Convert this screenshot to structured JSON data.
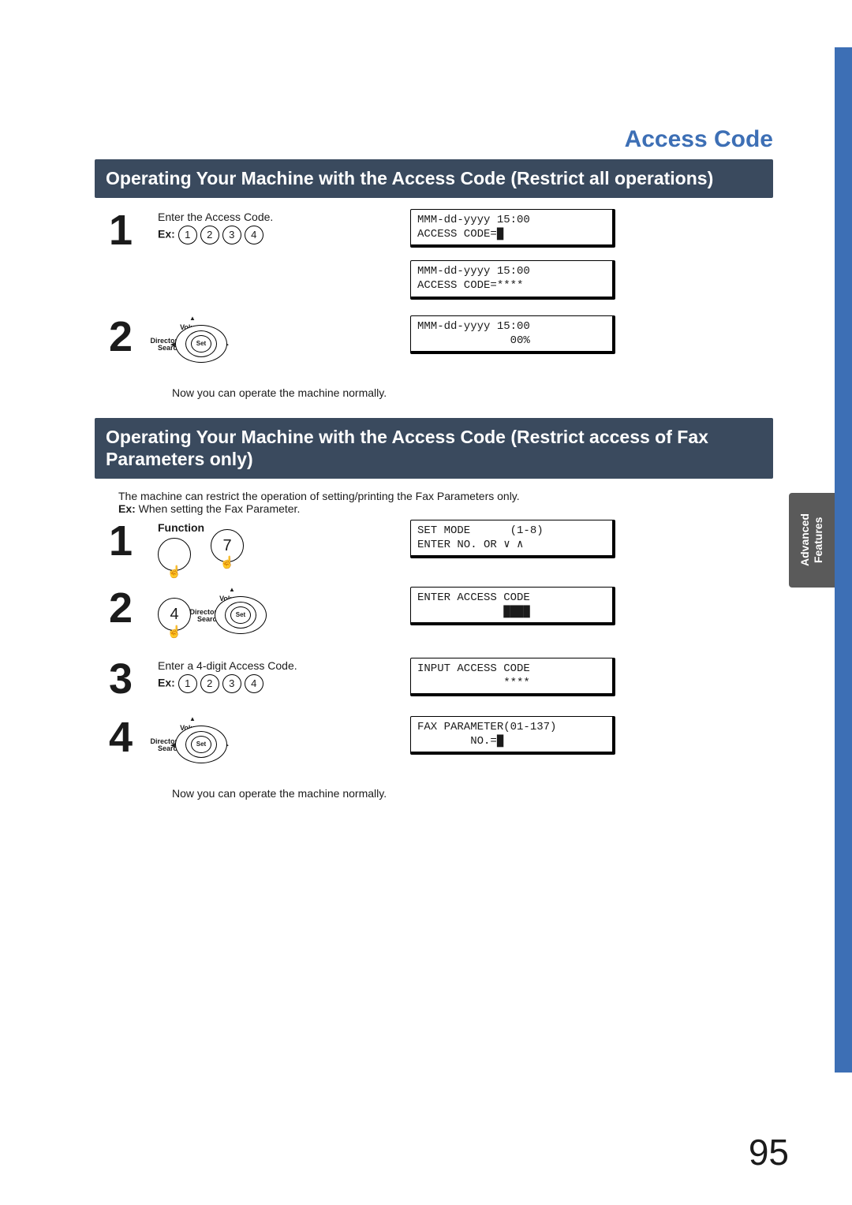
{
  "pageTitle": "Access Code",
  "sideTab": "Advanced\nFeatures",
  "sectionA": {
    "heading": "Operating Your Machine with the Access Code (Restrict all operations)",
    "step1": {
      "num": "1",
      "text": "Enter the Access Code.",
      "exLabel": "Ex:",
      "digits": [
        "1",
        "2",
        "3",
        "4"
      ],
      "lcd1": "MMM-dd-yyyy 15:00\nACCESS CODE=█",
      "lcd2": "MMM-dd-yyyy 15:00\nACCESS CODE=****"
    },
    "step2": {
      "num": "2",
      "lcd": "MMM-dd-yyyy 15:00\n              00%",
      "note": "Now you can operate the machine normally.",
      "nav": {
        "volume": "Volume",
        "set": "Set",
        "dir": "Directory\nSearch"
      }
    }
  },
  "sectionB": {
    "heading": "Operating Your Machine with the Access Code (Restrict access of Fax Parameters only)",
    "introLine1": "The machine can restrict the operation of setting/printing the Fax Parameters only.",
    "introExLabel": "Ex:",
    "introLine2": " When setting the Fax Parameter.",
    "step1": {
      "num": "1",
      "funcLabel": "Function",
      "key": "7",
      "lcd": "SET MODE      (1-8)\nENTER NO. OR ∨ ∧"
    },
    "step2": {
      "num": "2",
      "key": "4",
      "nav": {
        "volume": "Volume",
        "set": "Set",
        "dir": "Directory\nSearch"
      },
      "lcd": "ENTER ACCESS CODE\n             ████"
    },
    "step3": {
      "num": "3",
      "text": "Enter a 4-digit Access Code.",
      "exLabel": "Ex:",
      "digits": [
        "1",
        "2",
        "3",
        "4"
      ],
      "lcd": "INPUT ACCESS CODE\n             ****"
    },
    "step4": {
      "num": "4",
      "nav": {
        "volume": "Volume",
        "set": "Set",
        "dir": "Directory\nSearch"
      },
      "lcd": "FAX PARAMETER(01-137)\n        NO.=█",
      "note": "Now you can operate the machine normally."
    }
  },
  "pageNumber": "95"
}
